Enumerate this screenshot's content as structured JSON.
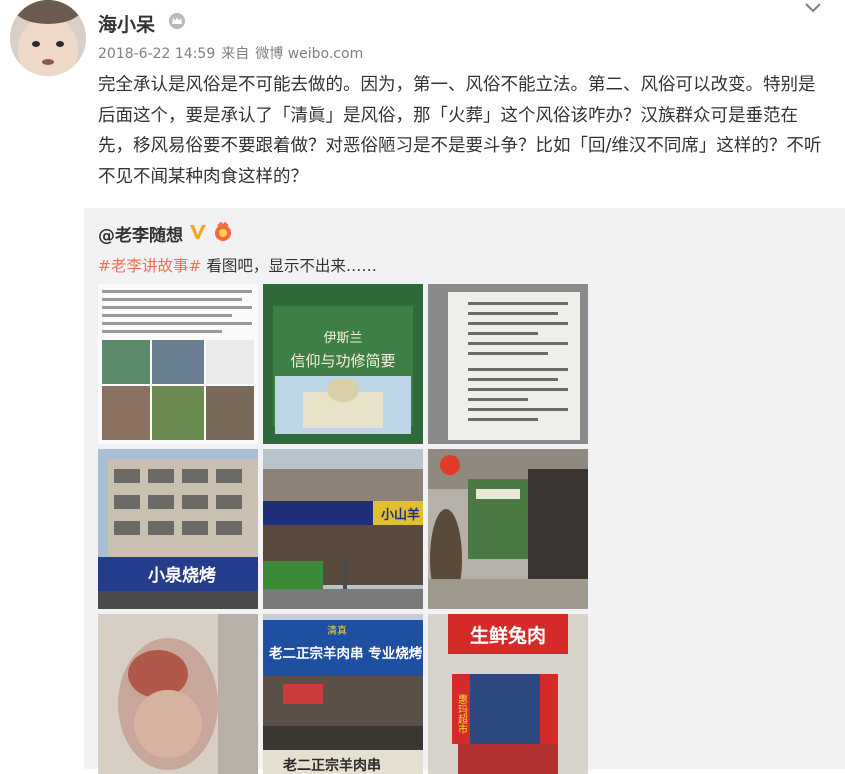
{
  "post": {
    "username": "海小呆",
    "date": "2018-6-22 14:59",
    "via": "来自",
    "source": "微博 weibo.com",
    "text": "完全承认是风俗是不可能去做的。因为，第一、风俗不能立法。第二、风俗可以改变。特别是后面这个，要是承认了「清眞」是风俗，那「火葬」这个风俗该咋办？汉族群众可是垂范在先，移风易俗要不要跟着做？对恶俗陋习是不是要斗争？比如「回/维汉不同席」这样的？不听不见不闻某种肉食这样的？"
  },
  "repost": {
    "username": "@老李随想",
    "hashtag": "#老李讲故事#",
    "text": "看图吧，显示不出来……"
  },
  "images": {
    "book_title_1": "伊斯兰",
    "book_title_2": "信仰与功修简要",
    "sign_xiaoquan": "小泉烧烤",
    "sign_xiaoshanyang": "小山羊",
    "sign_laoer_top": "老二正宗羊肉串 专业烧烤",
    "sign_qingzhen": "清真",
    "sign_shengxian": "生鲜兔肉",
    "sign_huima": "惠玛超市",
    "sign_laoer_bottom": "老二正宗羊肉串"
  },
  "colors": {
    "link": "#eb7350",
    "meta": "#808080",
    "repost_bg": "#f2f2f5",
    "vip_gold": "#f5a623"
  }
}
